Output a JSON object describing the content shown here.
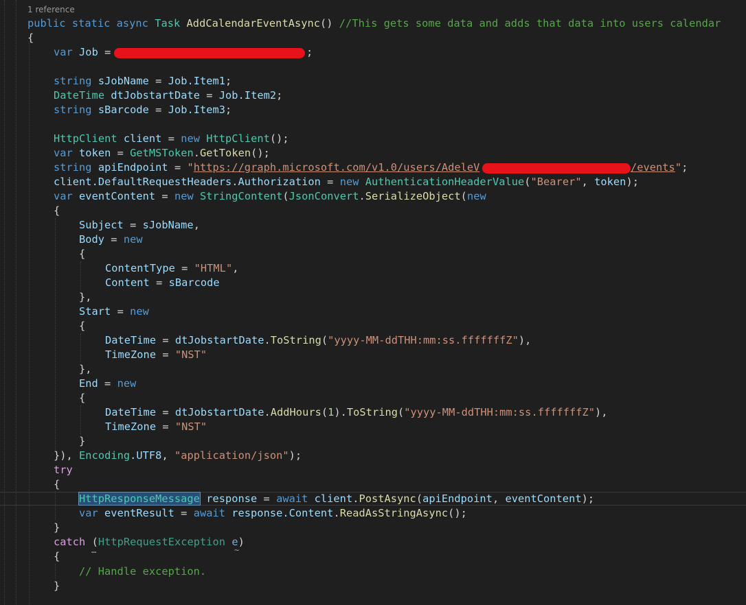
{
  "codelens": "1 reference",
  "code": {
    "signature": {
      "kw_public": "public",
      "kw_static": "static",
      "kw_async": "async",
      "type_task": "Task",
      "method": "AddCalendarEventAsync",
      "parens": "()",
      "comment": "//This gets some data and adds that data into users calendar"
    },
    "open_brace": "{",
    "l_var_job": {
      "kw": "var",
      "name": "Job",
      "op": " = ",
      "end": ";"
    },
    "l_jobname": {
      "kw": "string",
      "name": "sJobName",
      "op": " = ",
      "obj": "Job",
      "prop": ".Item1",
      "end": ";"
    },
    "l_startdate": {
      "kw": "DateTime",
      "name": "dtJobstartDate",
      "op": " = ",
      "obj": "Job",
      "prop": ".Item2",
      "end": ";"
    },
    "l_barcode": {
      "kw": "string",
      "name": "sBarcode",
      "op": " = ",
      "obj": "Job",
      "prop": ".Item3",
      "end": ";"
    },
    "l_client": {
      "type": "HttpClient",
      "name": "client",
      "op": " = ",
      "kw_new": "new",
      "type2": "HttpClient",
      "end": "();"
    },
    "l_token": {
      "kw": "var",
      "name": "token",
      "op": " = ",
      "cls": "GetMSToken",
      "dot": ".",
      "fn": "GetToken",
      "end": "();"
    },
    "l_api": {
      "kw": "string",
      "name": "apiEndpoint",
      "op": " = ",
      "q": "\"",
      "url_start": "https://graph.microsoft.com/v1.0/users/AdeleV",
      "url_end": "/events",
      "q2": "\"",
      "end": ";"
    },
    "l_auth": {
      "obj": "client",
      "p1": ".DefaultRequestHeaders",
      "p2": ".Authorization",
      "op": " = ",
      "kw_new": "new",
      "type": "AuthenticationHeaderValue",
      "open": "(",
      "str": "\"Bearer\"",
      "comma": ", ",
      "arg": "token",
      "end": ");"
    },
    "l_content": {
      "kw": "var",
      "name": "eventContent",
      "op": " = ",
      "kw_new": "new",
      "type": "StringContent",
      "open": "(",
      "cls": "JsonConvert",
      "dot": ".",
      "fn": "SerializeObject",
      "open2": "(",
      "kw_new2": "new"
    },
    "brace_obj": "{",
    "l_subject": {
      "prop": "Subject",
      "op": " = ",
      "val": "sJobName",
      "end": ","
    },
    "l_body": {
      "prop": "Body",
      "op": " = ",
      "kw_new": "new"
    },
    "brace_body": "{",
    "l_ctype": {
      "prop": "ContentType",
      "op": " = ",
      "str": "\"HTML\"",
      "end": ","
    },
    "l_content_prop": {
      "prop": "Content",
      "op": " = ",
      "val": "sBarcode"
    },
    "close_body": "},",
    "l_start": {
      "prop": "Start",
      "op": " = ",
      "kw_new": "new"
    },
    "brace_start": "{",
    "l_start_dt": {
      "prop": "DateTime",
      "op": " = ",
      "obj": "dtJobstartDate",
      "dot": ".",
      "fn": "ToString",
      "open": "(",
      "str": "\"yyyy-MM-ddTHH:mm:ss.fffffffZ\"",
      "end": "),"
    },
    "l_start_tz": {
      "prop": "TimeZone",
      "op": " = ",
      "str": "\"NST\""
    },
    "close_start": "},",
    "l_end": {
      "prop": "End",
      "op": " = ",
      "kw_new": "new"
    },
    "brace_end": "{",
    "l_end_dt": {
      "prop": "DateTime",
      "op": " = ",
      "obj": "dtJobstartDate",
      "dot": ".",
      "fn": "AddHours",
      "open": "(",
      "num": "1",
      "close": ")",
      "dot2": ".",
      "fn2": "ToString",
      "open2": "(",
      "str": "\"yyyy-MM-ddTHH:mm:ss.fffffffZ\"",
      "end": "),"
    },
    "l_end_tz": {
      "prop": "TimeZone",
      "op": " = ",
      "str": "\"NST\""
    },
    "close_end": "}",
    "l_close_obj": {
      "p": "}), ",
      "cls": "Encoding",
      "prop": ".UTF8",
      "comma": ", ",
      "str": "\"application/json\"",
      "end": ");"
    },
    "kw_try": "try",
    "brace_try": "{",
    "l_response": {
      "type": "HttpResponseMessage",
      "name": "response",
      "op": " = ",
      "kw_await": "await",
      "obj": "client",
      "dot": ".",
      "fn": "PostAsync",
      "open": "(",
      "a1": "apiEndpoint",
      "comma": ", ",
      "a2": "eventContent",
      "end": ");"
    },
    "l_result": {
      "kw": "var",
      "name": "eventResult",
      "op": " = ",
      "kw_await": "await",
      "obj": "response",
      "prop": ".Content",
      "dot": ".",
      "fn": "ReadAsStringAsync",
      "end": "();"
    },
    "close_try": "}",
    "l_catch": {
      "kw": "catch",
      "open": " (",
      "type": "HttpRequestException",
      "sp": " ",
      "name": "e",
      "close": ")"
    },
    "brace_catch": "{",
    "l_handle": {
      "comment": "// Handle exception."
    },
    "close_catch": "}"
  },
  "colors": {
    "background": "#1f1f1f",
    "keyword": "#569cd6",
    "control": "#d8a0df",
    "type": "#4ec9b0",
    "method": "#dcdcaa",
    "variable": "#9cdcfe",
    "string": "#ce9178",
    "comment": "#57a64a",
    "redaction": "#e8121b"
  }
}
